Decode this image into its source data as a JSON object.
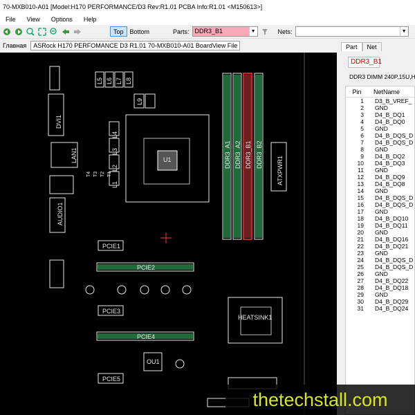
{
  "window": {
    "title": "70-MXB010-A01 [Model:H170 PERFORMANCE/D3 Rev:R1.01 PCBA Info:R1.01     <M150613>]"
  },
  "menu": [
    "File",
    "View",
    "Options",
    "Help"
  ],
  "toolbar": {
    "top_label": "Top",
    "bottom_label": "Bottom",
    "parts_label": "Parts:",
    "parts_value": "DDR3_B1",
    "nets_label": "Nets:",
    "nets_value": ""
  },
  "pathbar": {
    "label": "Главная",
    "path": "ASRock H170 PERFOMANCE D3 R1.01 70-MXB010-A01 BoardView File"
  },
  "board": {
    "labels": [
      "U1",
      "DDR3_A1",
      "DDR3_A2",
      "DDR3_B1",
      "DDR3_B2",
      "ATXPWR1",
      "PCIE1",
      "PCIE2",
      "PCIE3",
      "PCIE4",
      "PCIE5",
      "HEATSINK1",
      "OU1",
      "AUDIO1",
      "DVI1",
      "LAN1",
      "L1",
      "L2",
      "L3",
      "L4",
      "L5",
      "L6",
      "L7",
      "L8",
      "L9",
      "T4",
      "T3",
      "T2",
      "T1"
    ],
    "colors": {
      "background": "#000000",
      "outline": "#e8e8e8",
      "highlight": "#ff3333",
      "pad": "#1f6b3a"
    }
  },
  "panel": {
    "tabs": [
      "Part",
      "Net"
    ],
    "part_name": "DDR3_B1",
    "part_desc": "DDR3 DIMM 240P,15U,H",
    "columns": [
      "Pin",
      "NetName"
    ],
    "pins": [
      [
        "1",
        "D3_B_VREF_"
      ],
      [
        "2",
        "GND"
      ],
      [
        "3",
        "D4_B_DQ1"
      ],
      [
        "4",
        "D4_B_DQ0"
      ],
      [
        "5",
        "GND"
      ],
      [
        "6",
        "D4_B_DQS_D"
      ],
      [
        "7",
        "D4_B_DQS_D"
      ],
      [
        "8",
        "GND"
      ],
      [
        "9",
        "D4_B_DQ2"
      ],
      [
        "10",
        "D4_B_DQ3"
      ],
      [
        "11",
        "GND"
      ],
      [
        "12",
        "D4_B_DQ9"
      ],
      [
        "13",
        "D4_B_DQ8"
      ],
      [
        "14",
        "GND"
      ],
      [
        "15",
        "D4_B_DQS_D"
      ],
      [
        "16",
        "D4_B_DQS_D"
      ],
      [
        "17",
        "GND"
      ],
      [
        "18",
        "D4_B_DQ10"
      ],
      [
        "19",
        "D4_B_DQ11"
      ],
      [
        "20",
        "GND"
      ],
      [
        "21",
        "D4_B_DQ16"
      ],
      [
        "22",
        "D4_B_DQ21"
      ],
      [
        "23",
        "GND"
      ],
      [
        "24",
        "D4_B_DQS_D"
      ],
      [
        "25",
        "D4_B_DQS_D"
      ],
      [
        "26",
        "GND"
      ],
      [
        "27",
        "D4_B_DQ22"
      ],
      [
        "28",
        "D4_B_DQ18"
      ],
      [
        "29",
        "GND"
      ],
      [
        "30",
        "D4_B_DQ29"
      ],
      [
        "31",
        "D4_B_DQ24"
      ]
    ]
  },
  "watermark": "thetechstall.com"
}
